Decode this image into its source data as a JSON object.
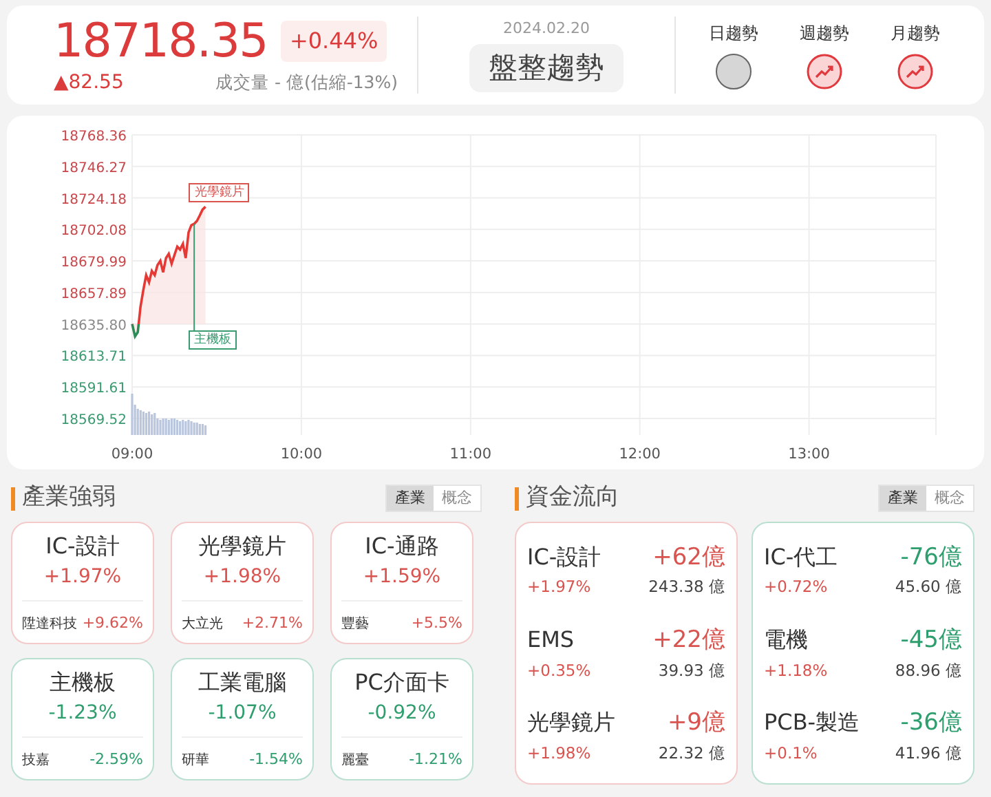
{
  "quote": {
    "price": "18718.35",
    "change_pct": "+0.44%",
    "change": "▲82.55",
    "volume": "成交量 - 億(估縮-13%)",
    "date": "2024.02.20",
    "trend_label": "盤整趨勢"
  },
  "trends": [
    {
      "label": "日趨勢",
      "kind": "flat"
    },
    {
      "label": "週趨勢",
      "kind": "up"
    },
    {
      "label": "月趨勢",
      "kind": "up"
    }
  ],
  "chart": {
    "chart_data": {
      "type": "area",
      "x": [
        9,
        9.0167,
        9.0333,
        9.05,
        9.0667,
        9.0833,
        9.1,
        9.1167,
        9.1333,
        9.15,
        9.1667,
        9.1833,
        9.2,
        9.2167,
        9.2333,
        9.25,
        9.2667,
        9.2833,
        9.3,
        9.3167,
        9.3333,
        9.35,
        9.3667,
        9.3833,
        9.4,
        9.4167,
        9.4333
      ],
      "series": [
        {
          "color": "#e53935",
          "values": [
            18635.8,
            18627,
            18630,
            18648,
            18660,
            18670,
            18665,
            18673,
            18670,
            18677,
            18680,
            18672,
            18682,
            18685,
            18678,
            18684,
            18690,
            18688,
            18692,
            18682,
            18700,
            18705,
            18706,
            18708,
            18712,
            18716,
            18718
          ]
        }
      ],
      "grid": true,
      "xlim": [
        9,
        13.75
      ],
      "ylim": [
        18556,
        18768.36
      ],
      "xticks": [
        {
          "value": 9,
          "label": "09:00"
        },
        {
          "value": 10,
          "label": "10:00"
        },
        {
          "value": 11,
          "label": "11:00"
        },
        {
          "value": 12,
          "label": "12:00"
        },
        {
          "value": 13,
          "label": "13:00"
        }
      ],
      "yticks": [
        {
          "value": 18768.36,
          "label": "18768.36"
        },
        {
          "value": 18746.27,
          "label": "18746.27"
        },
        {
          "value": 18724.18,
          "label": "18724.18"
        },
        {
          "value": 18702.08,
          "label": "18702.08"
        },
        {
          "value": 18679.99,
          "label": "18679.99"
        },
        {
          "value": 18657.89,
          "label": "18657.89"
        },
        {
          "value": 18635.8,
          "label": "18635.80"
        },
        {
          "value": 18613.71,
          "label": "18613.71"
        },
        {
          "value": 18591.61,
          "label": "18591.61"
        },
        {
          "value": 18569.52,
          "label": "18569.52"
        }
      ],
      "annotations": [
        {
          "text": "光學鏡片",
          "x": 9.4333,
          "y": 18718
        },
        {
          "text": "主機板",
          "x": 9.3667,
          "y": 18706
        }
      ]
    }
  },
  "industry": {
    "title": "產業強弱",
    "tabs": [
      {
        "label": "產業",
        "selected": true
      },
      {
        "label": "概念",
        "selected": false
      }
    ],
    "cards": [
      {
        "name": "IC-設計",
        "change": "+1.97%",
        "stock": "陞達科技",
        "stock_change": "+9.62%",
        "kind": "up"
      },
      {
        "name": "光學鏡片",
        "change": "+1.98%",
        "stock": "大立光",
        "stock_change": "+2.71%",
        "kind": "up"
      },
      {
        "name": "IC-通路",
        "change": "+1.59%",
        "stock": "豐藝",
        "stock_change": "+5.5%",
        "kind": "up"
      },
      {
        "name": "主機板",
        "change": "-1.23%",
        "stock": "技嘉",
        "stock_change": "-2.59%",
        "kind": "down"
      },
      {
        "name": "工業電腦",
        "change": "-1.07%",
        "stock": "研華",
        "stock_change": "-1.54%",
        "kind": "down"
      },
      {
        "name": "PC介面卡",
        "change": "-0.92%",
        "stock": "麗臺",
        "stock_change": "-1.21%",
        "kind": "down"
      }
    ]
  },
  "fund_flow": {
    "title": "資金流向",
    "tabs": [
      {
        "label": "產業",
        "selected": true
      },
      {
        "label": "概念",
        "selected": false
      }
    ],
    "columns": [
      {
        "kind": "inflow",
        "rows": [
          {
            "name": "IC-設計",
            "flow": "+62億",
            "change": "+1.97%",
            "amount": "243.38 億"
          },
          {
            "name": "EMS",
            "flow": "+22億",
            "change": "+0.35%",
            "amount": "39.93 億"
          },
          {
            "name": "光學鏡片",
            "flow": "+9億",
            "change": "+1.98%",
            "amount": "22.32 億"
          }
        ]
      },
      {
        "kind": "outflow",
        "rows": [
          {
            "name": "IC-代工",
            "flow": "-76億",
            "change": "+0.72%",
            "amount": "45.60 億"
          },
          {
            "name": "電機",
            "flow": "-45億",
            "change": "+1.18%",
            "amount": "88.96 億"
          },
          {
            "name": "PCB-製造",
            "flow": "-36億",
            "change": "+0.1%",
            "amount": "41.96 億"
          }
        ]
      }
    ]
  }
}
